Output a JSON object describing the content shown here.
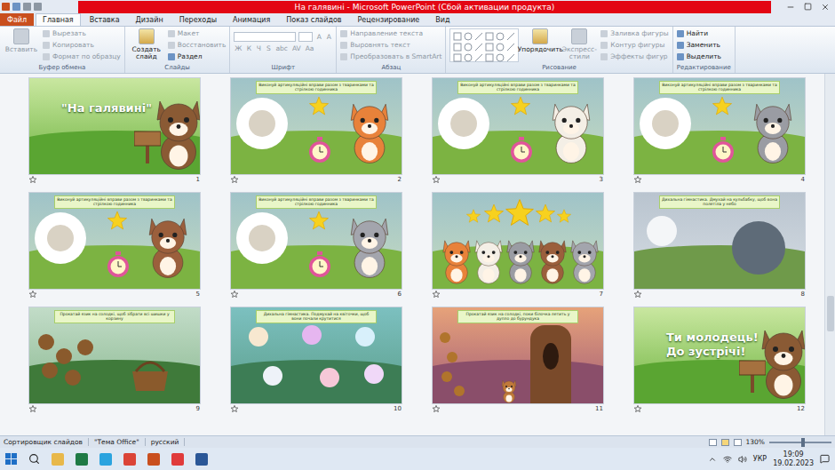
{
  "window": {
    "title": "На галявині - Microsoft PowerPoint (Сбой активации продукта)"
  },
  "tabs": [
    {
      "label": "Файл",
      "selected": false,
      "kind": "file"
    },
    {
      "label": "Главная",
      "selected": true,
      "kind": "tab"
    },
    {
      "label": "Вставка",
      "selected": false,
      "kind": "tab"
    },
    {
      "label": "Дизайн",
      "selected": false,
      "kind": "tab"
    },
    {
      "label": "Переходы",
      "selected": false,
      "kind": "tab"
    },
    {
      "label": "Анимация",
      "selected": false,
      "kind": "tab"
    },
    {
      "label": "Показ слайдов",
      "selected": false,
      "kind": "tab"
    },
    {
      "label": "Рецензирование",
      "selected": false,
      "kind": "tab"
    },
    {
      "label": "Вид",
      "selected": false,
      "kind": "tab"
    }
  ],
  "ribbon": {
    "groups": [
      {
        "label": "Буфер обмена",
        "kind": "buttons",
        "items": [
          {
            "label": "Вставить",
            "kind": "large",
            "disabled": true
          },
          {
            "label": "Вырезать",
            "kind": "small",
            "disabled": true
          },
          {
            "label": "Копировать",
            "kind": "small",
            "disabled": true
          },
          {
            "label": "Формат по образцу",
            "kind": "small",
            "disabled": true
          }
        ]
      },
      {
        "label": "Слайды",
        "kind": "buttons",
        "items": [
          {
            "label": "Создать слайд",
            "kind": "large",
            "disabled": false
          },
          {
            "label": "Макет",
            "kind": "small",
            "disabled": true
          },
          {
            "label": "Восстановить",
            "kind": "small",
            "disabled": true
          },
          {
            "label": "Раздел",
            "kind": "small",
            "disabled": false
          }
        ]
      },
      {
        "label": "Шрифт",
        "kind": "font",
        "items": [
          {
            "label": "A",
            "kind": "key",
            "disabled": true
          },
          {
            "label": "A",
            "kind": "key",
            "disabled": true
          },
          {
            "label": "Ж",
            "kind": "key",
            "disabled": true
          },
          {
            "label": "К",
            "kind": "key",
            "disabled": true
          },
          {
            "label": "Ч",
            "kind": "key",
            "disabled": true
          },
          {
            "label": "S",
            "kind": "key",
            "disabled": true
          },
          {
            "label": "abc",
            "kind": "key",
            "disabled": true
          },
          {
            "label": "AV",
            "kind": "key",
            "disabled": true
          },
          {
            "label": "Aa",
            "kind": "key",
            "disabled": true
          }
        ]
      },
      {
        "label": "Абзац",
        "kind": "buttons",
        "items": [
          {
            "label": "Направление текста",
            "kind": "small",
            "disabled": true
          },
          {
            "label": "Выровнять текст",
            "kind": "small",
            "disabled": true
          },
          {
            "label": "Преобразовать в SmartArt",
            "kind": "small",
            "disabled": true
          }
        ]
      },
      {
        "label": "Рисование",
        "kind": "drawing",
        "items": [
          {
            "label": "Упорядочить",
            "kind": "large",
            "disabled": false
          },
          {
            "label": "Экспресс-стили",
            "kind": "large",
            "disabled": true
          },
          {
            "label": "Заливка фигуры",
            "kind": "small",
            "disabled": true
          },
          {
            "label": "Контур фигуры",
            "kind": "small",
            "disabled": true
          },
          {
            "label": "Эффекты фигур",
            "kind": "small",
            "disabled": true
          }
        ]
      },
      {
        "label": "Редактирование",
        "kind": "buttons",
        "items": [
          {
            "label": "Найти",
            "kind": "small",
            "disabled": false
          },
          {
            "label": "Заменить",
            "kind": "small",
            "disabled": false
          },
          {
            "label": "Выделить",
            "kind": "small",
            "disabled": false
          }
        ]
      }
    ]
  },
  "slides": [
    {
      "number": "1",
      "kind": "title",
      "title_lines": [
        "\"На галявині\""
      ]
    },
    {
      "number": "2",
      "kind": "exercise",
      "caption": "Виконуй артикуляційні вправи разом з тваринками та стрілкою годинника",
      "color": "#e8823a"
    },
    {
      "number": "3",
      "kind": "exercise",
      "caption": "Виконуй артикуляційні вправи разом з тваринками та стрілкою годинника",
      "color": "#f4efe6"
    },
    {
      "number": "4",
      "kind": "exercise",
      "caption": "Виконуй артикуляційні вправи разом з тваринками та стрілкою годинника",
      "color": "#9a9ca3"
    },
    {
      "number": "5",
      "kind": "exercise",
      "caption": "Виконуй артикуляційні вправи разом з тваринками та стрілкою годинника",
      "color": "#9b5f3c"
    },
    {
      "number": "6",
      "kind": "exercise",
      "caption": "Виконуй артикуляційні вправи разом з тваринками та стрілкою годинника",
      "color": "#a3a5ad"
    },
    {
      "number": "7",
      "kind": "stars",
      "animals": [
        {
          "color": "#e8823a"
        },
        {
          "color": "#f4efe6"
        },
        {
          "color": "#9a9ca3"
        },
        {
          "color": "#9b5f3c"
        },
        {
          "color": "#a3a5ad"
        }
      ]
    },
    {
      "number": "8",
      "kind": "dandelion",
      "caption": "Дихальна гімнастика. Дмухай на кульбабку, щоб вона полетіла у небо"
    },
    {
      "number": "9",
      "kind": "cones",
      "caption": "Прокатай язик на солодкі, щоб зібрати всі шишки у корзину"
    },
    {
      "number": "10",
      "kind": "flowers",
      "caption": "Дихальна гімнастика. Подмухай на квіточки, щоб вони почали крутитися"
    },
    {
      "number": "11",
      "kind": "squirrel",
      "caption": "Прокатай язик на солодкі, поки білочка летить у дупло до бурундука"
    },
    {
      "number": "12",
      "kind": "final",
      "title_lines": [
        "Ти молодець!",
        "До зустрічі!"
      ]
    }
  ],
  "status_bar": {
    "items": [
      "Сортировщик слайдов",
      "\"Тема Office\"",
      "русский"
    ],
    "zoom": "130%",
    "zoom_level": 0.55
  },
  "taskbar": {
    "language": "УКР",
    "time": "19:09",
    "date": "19.02.2023"
  }
}
